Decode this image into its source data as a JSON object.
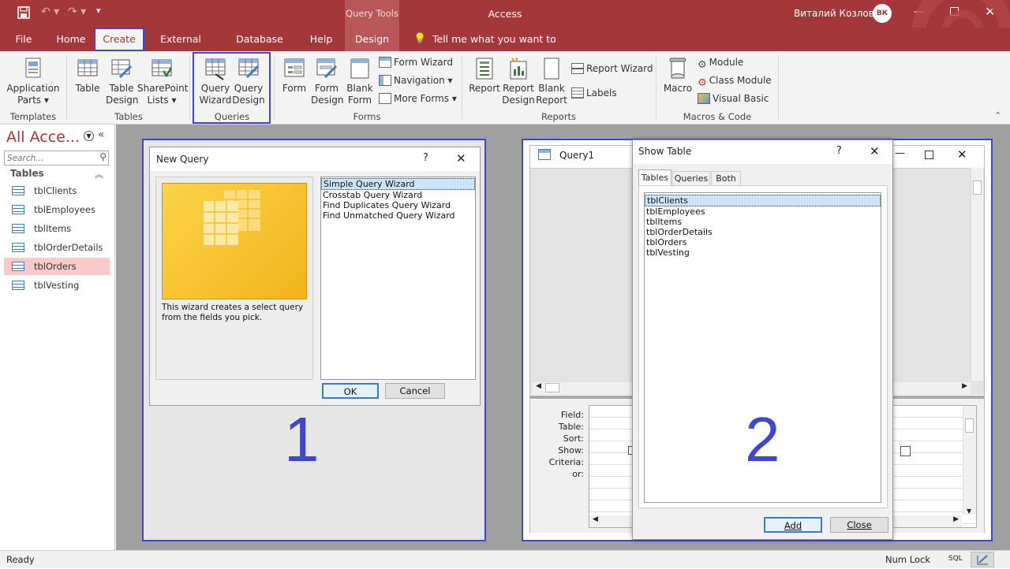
{
  "title_bar": {
    "context_tab": "Query Tools",
    "app_title": "Access",
    "user_name": "Виталий Козлов",
    "user_initials": "ВК"
  },
  "tabs": [
    "File",
    "Home",
    "Create",
    "External Data",
    "Database Tools",
    "Help",
    "Design"
  ],
  "tell_me": "Tell me what you want to do",
  "ribbon": {
    "templates": {
      "application_parts": "Application",
      "application_parts_2": "Parts ▾",
      "group": "Templates"
    },
    "tables": {
      "table": "Table",
      "table_design_1": "Table",
      "table_design_2": "Design",
      "sharepoint_1": "SharePoint",
      "sharepoint_2": "Lists ▾",
      "group": "Tables"
    },
    "queries": {
      "wizard_1": "Query",
      "wizard_2": "Wizard",
      "design_1": "Query",
      "design_2": "Design",
      "group": "Queries"
    },
    "forms": {
      "form": "Form",
      "form_design_1": "Form",
      "form_design_2": "Design",
      "blank_form_1": "Blank",
      "blank_form_2": "Form",
      "form_wizard": "Form Wizard",
      "navigation": "Navigation ▾",
      "more_forms": "More Forms ▾",
      "group": "Forms"
    },
    "reports": {
      "report": "Report",
      "report_design_1": "Report",
      "report_design_2": "Design",
      "blank_report_1": "Blank",
      "blank_report_2": "Report",
      "report_wizard": "Report Wizard",
      "labels": "Labels",
      "group": "Reports"
    },
    "macros": {
      "macro": "Macro",
      "module": "Module",
      "class_module": "Class Module",
      "visual_basic": "Visual Basic",
      "group": "Macros & Code"
    }
  },
  "nav": {
    "title": "All Acce...",
    "search_placeholder": "Search...",
    "section": "Tables",
    "items": [
      "tblClients",
      "tblEmployees",
      "tblItems",
      "tblOrderDetails",
      "tblOrders",
      "tblVesting"
    ],
    "selected_index": 4
  },
  "new_query": {
    "title": "New Query",
    "help": "?",
    "options": [
      "Simple Query Wizard",
      "Crosstab Query Wizard",
      "Find Duplicates Query Wizard",
      "Find Unmatched Query Wizard"
    ],
    "description": "This wizard creates a select query from the fields you pick.",
    "ok": "OK",
    "cancel": "Cancel"
  },
  "query1": {
    "title": "Query1",
    "grid_labels": [
      "Field:",
      "Table:",
      "Sort:",
      "Show:",
      "Criteria:",
      "or:"
    ]
  },
  "show_table": {
    "title": "Show Table",
    "help": "?",
    "tabs": [
      "Tables",
      "Queries",
      "Both"
    ],
    "items": [
      "tblClients",
      "tblEmployees",
      "tblItems",
      "tblOrderDetails",
      "tblOrders",
      "tblVesting"
    ],
    "add": "Add",
    "close": "Close"
  },
  "annotations": {
    "one": "1",
    "two": "2"
  },
  "status": {
    "left": "Ready",
    "num_lock": "Num Lock",
    "sql": "SQL"
  },
  "colors": {
    "accent": "#a4373a",
    "highlight": "#3f48cc",
    "selected_nav": "#fcc8c8"
  }
}
